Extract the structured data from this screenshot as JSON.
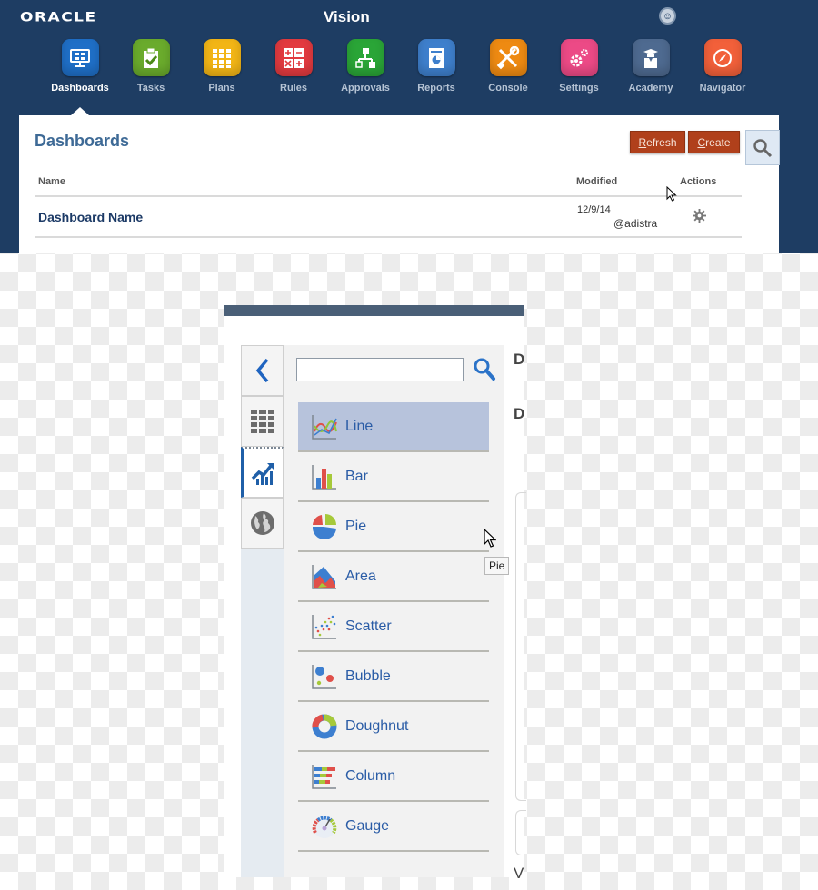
{
  "header": {
    "brand": "ORACLE",
    "app_title": "Vision",
    "accessibility_icon": "accessibility-icon"
  },
  "nav": {
    "active": "Dashboards",
    "items": [
      {
        "label": "Dashboards",
        "icon": "monitor-icon",
        "color": "#1f6fc7"
      },
      {
        "label": "Tasks",
        "icon": "clipboard-check-icon",
        "color": "#6aab2c"
      },
      {
        "label": "Plans",
        "icon": "grid-icon",
        "color": "#f2b516"
      },
      {
        "label": "Rules",
        "icon": "calculator-icon",
        "color": "#e23a3f"
      },
      {
        "label": "Approvals",
        "icon": "hierarchy-icon",
        "color": "#2aa537"
      },
      {
        "label": "Reports",
        "icon": "report-icon",
        "color": "#3e7fcc"
      },
      {
        "label": "Console",
        "icon": "tools-icon",
        "color": "#ee8a12"
      },
      {
        "label": "Settings",
        "icon": "gears-icon",
        "color": "#ec4a86"
      },
      {
        "label": "Academy",
        "icon": "graduate-icon",
        "color": "#4e6a90"
      },
      {
        "label": "Navigator",
        "icon": "compass-icon",
        "color": "#f2603a"
      }
    ]
  },
  "dashboards_panel": {
    "title": "Dashboards",
    "refresh_label": {
      "accel": "R",
      "rest": "efresh"
    },
    "create_label": {
      "accel": "C",
      "rest": "reate"
    },
    "search_icon": "search-icon",
    "columns": {
      "name": "Name",
      "modified": "Modified",
      "actions": "Actions"
    },
    "rows": [
      {
        "name": "Dashboard Name",
        "modified_date": "12/9/14",
        "modified_by": "@adistra",
        "action_icon": "gear-icon"
      }
    ]
  },
  "chart_gallery": {
    "search": {
      "value": "",
      "placeholder": ""
    },
    "side_tabs": [
      {
        "name": "collapse",
        "icon": "chevron-left-icon"
      },
      {
        "name": "table",
        "icon": "table-grid-icon"
      },
      {
        "name": "charts",
        "icon": "chart-trend-icon",
        "active": true
      },
      {
        "name": "geo-map",
        "icon": "globe-icon"
      }
    ],
    "items": [
      {
        "label": "Line",
        "icon": "line-chart-icon",
        "selected": true
      },
      {
        "label": "Bar",
        "icon": "bar-chart-icon"
      },
      {
        "label": "Pie",
        "icon": "pie-chart-icon"
      },
      {
        "label": "Area",
        "icon": "area-chart-icon"
      },
      {
        "label": "Scatter",
        "icon": "scatter-chart-icon"
      },
      {
        "label": "Bubble",
        "icon": "bubble-chart-icon"
      },
      {
        "label": "Doughnut",
        "icon": "doughnut-chart-icon"
      },
      {
        "label": "Column",
        "icon": "column-chart-icon"
      },
      {
        "label": "Gauge",
        "icon": "gauge-chart-icon"
      }
    ],
    "tooltip": "Pie",
    "right_edge_letters": [
      "D",
      "D",
      "V"
    ]
  }
}
